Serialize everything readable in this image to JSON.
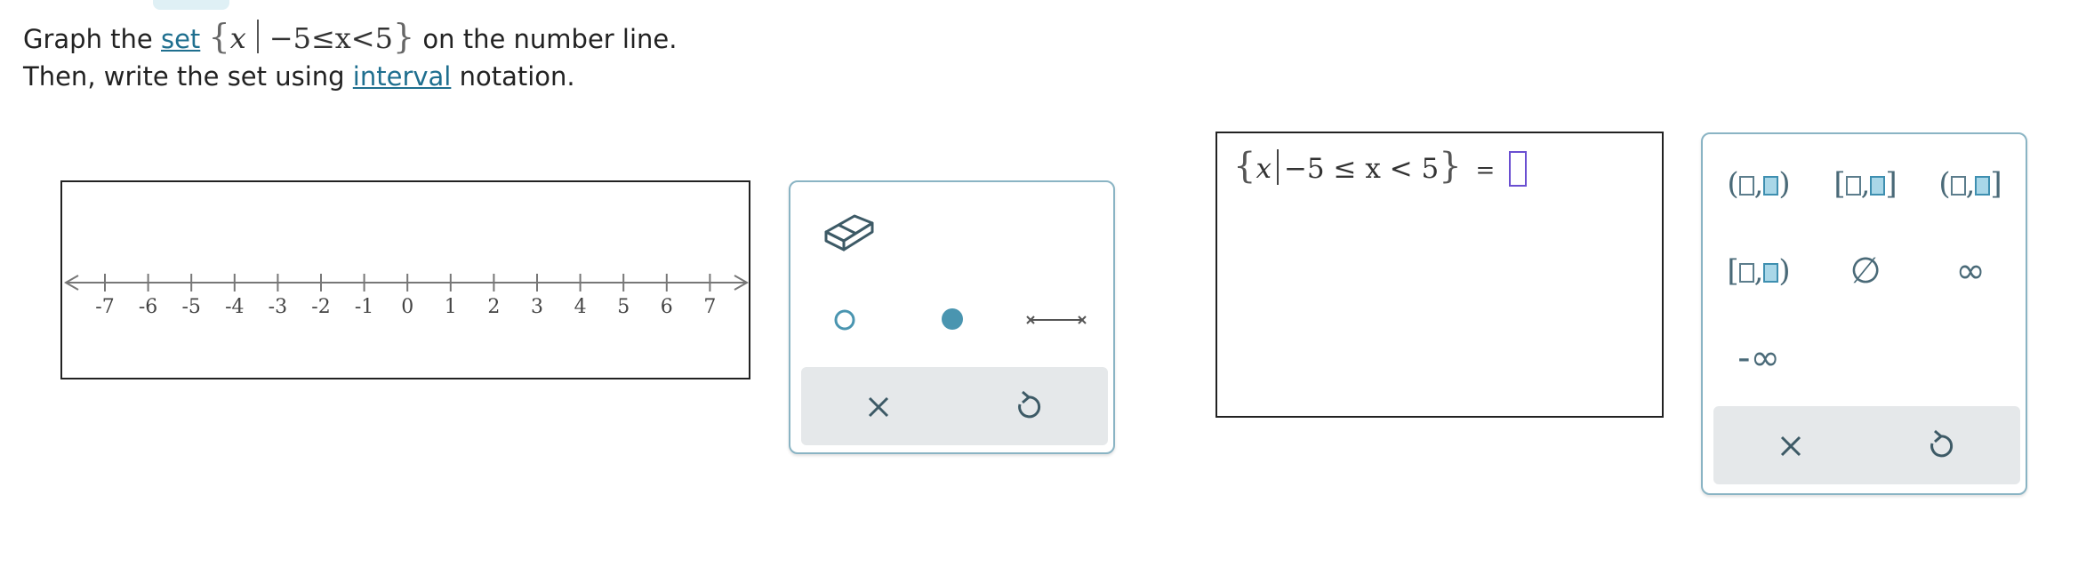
{
  "prompt": {
    "line1_before": "Graph the ",
    "set_link": "set",
    "math_open": "{",
    "math_var": "x",
    "math_condition": "−5≤x<5",
    "math_close": "}",
    "line1_after": " on the number line.",
    "line2_before": "Then, write the set using ",
    "interval_link": "interval",
    "line2_after": " notation."
  },
  "number_line": {
    "ticks": [
      "-7",
      "-6",
      "-5",
      "-4",
      "-3",
      "-2",
      "-1",
      "0",
      "1",
      "2",
      "3",
      "4",
      "5",
      "6",
      "7"
    ]
  },
  "graph_tools": {
    "eraser": "eraser-icon",
    "open_point": "open-circle-icon",
    "closed_point": "closed-circle-icon",
    "segment": "segment-icon",
    "clear": "close-icon",
    "undo": "undo-icon"
  },
  "answer": {
    "open_brace": "{",
    "var": "x",
    "condition": "−5 ≤ x < 5",
    "close_brace": "}",
    "equals": "="
  },
  "keypad": {
    "keys": [
      {
        "left": "(",
        "right": ")"
      },
      {
        "left": "[",
        "right": "]"
      },
      {
        "left": "(",
        "right": "]"
      },
      {
        "left": "[",
        "right": ")"
      }
    ],
    "empty_set": "∅",
    "infinity": "∞",
    "neg_infinity": "-∞",
    "clear": "close-icon",
    "undo": "undo-icon"
  },
  "colors": {
    "link": "#1f6f8f",
    "accent": "#4a95b0",
    "panel_border": "#8ab4c4",
    "cursor": "#6a4fd1"
  }
}
